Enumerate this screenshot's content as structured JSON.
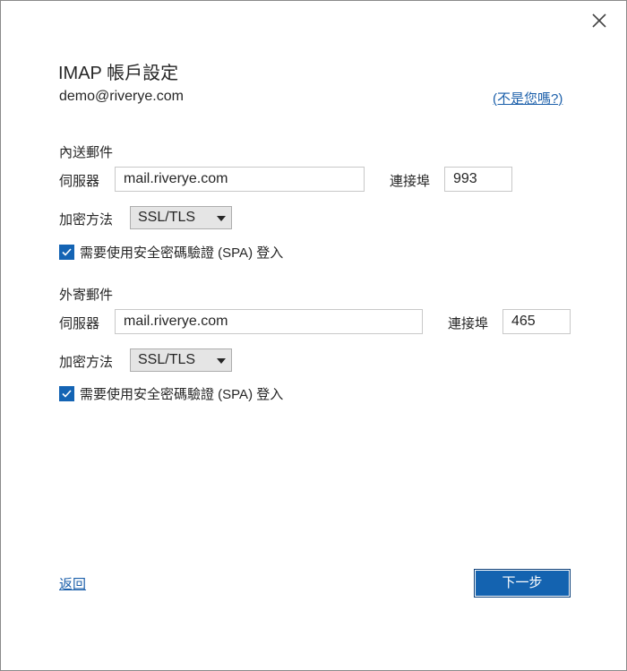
{
  "dialog": {
    "title": "IMAP 帳戶設定",
    "email": "demo@riverye.com",
    "not_you_link": "(不是您嗎?)",
    "close_icon": "close-icon"
  },
  "incoming": {
    "section_label": "內送郵件",
    "server_label": "伺服器",
    "server_value": "mail.riverye.com",
    "port_label": "連接埠",
    "port_value": "993",
    "encryption_label": "加密方法",
    "encryption_value": "SSL/TLS",
    "spa_label": "需要使用安全密碼驗證 (SPA) 登入",
    "spa_checked": true
  },
  "outgoing": {
    "section_label": "外寄郵件",
    "server_label": "伺服器",
    "server_value": "mail.riverye.com",
    "port_label": "連接埠",
    "port_value": "465",
    "encryption_label": "加密方法",
    "encryption_value": "SSL/TLS",
    "spa_label": "需要使用安全密碼驗證 (SPA) 登入",
    "spa_checked": true
  },
  "footer": {
    "back_label": "返回",
    "next_label": "下一步"
  },
  "colors": {
    "accent": "#1463b0",
    "link": "#1b5faa"
  }
}
